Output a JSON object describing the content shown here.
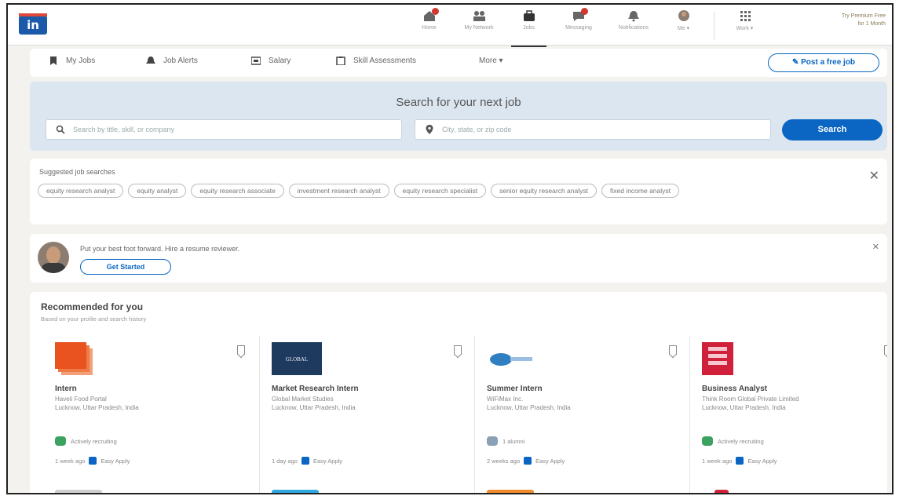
{
  "brand": {
    "logo_text": "in",
    "colors": {
      "primary": "#0a66c2",
      "background": "#f3f2ef",
      "search_panel": "#dce6f1",
      "badge": "#d3362f"
    }
  },
  "top_nav": {
    "items": [
      {
        "label": "Home",
        "icon": "home-icon",
        "badge": true
      },
      {
        "label": "My Network",
        "icon": "network-icon",
        "badge": false
      },
      {
        "label": "Jobs",
        "icon": "briefcase-icon",
        "badge": false,
        "active": true
      },
      {
        "label": "Messaging",
        "icon": "messaging-icon",
        "badge": true
      },
      {
        "label": "Notifications",
        "icon": "bell-icon",
        "badge": false
      },
      {
        "label": "Me ▾",
        "icon": "avatar",
        "badge": false
      },
      {
        "label": "Work ▾",
        "icon": "grid-icon",
        "badge": false
      }
    ],
    "premium_line1": "Try Premium Free",
    "premium_line2": "for 1 Month"
  },
  "sub_nav": {
    "my_jobs": "My Jobs",
    "job_alerts": "Job Alerts",
    "salary": "Salary",
    "skill_assessments": "Skill Assessments",
    "more": "More ▾",
    "post_job": "Post a free job"
  },
  "search": {
    "title": "Search for your next job",
    "keyword_placeholder": "Search by title, skill, or company",
    "location_placeholder": "City, state, or zip code",
    "button": "Search"
  },
  "suggested": {
    "title": "Suggested job searches",
    "close": "✕",
    "pills": [
      "equity research analyst",
      "equity analyst",
      "equity research associate",
      "investment research analyst",
      "equity research specialist",
      "senior equity research analyst",
      "fixed income analyst"
    ]
  },
  "resume": {
    "text": "Put your best foot forward. Hire a resume reviewer.",
    "button": "Get Started",
    "close": "✕"
  },
  "recommended": {
    "title": "Recommended for you",
    "subtitle": "Based on your profile and search history",
    "cards": [
      {
        "title": "Intern",
        "company": "Haveli Food Portal",
        "location": "Lucknow, Uttar Pradesh, India",
        "insight": "Actively recruiting",
        "posted": "1 week ago",
        "apply": "Easy Apply",
        "logo_color": "#e8531f",
        "insight_color": "#3aa35f"
      },
      {
        "title": "Market Research Intern",
        "company": "Global Market Studies",
        "location": "Lucknow, Uttar Pradesh, India",
        "logo_text": "GLOBAL",
        "insight": "",
        "posted": "1 day ago",
        "apply": "Easy Apply",
        "logo_color": "#1f3a5f",
        "insight_color": ""
      },
      {
        "title": "Summer Intern",
        "company": "WiFiMax Inc.",
        "location": "Lucknow, Uttar Pradesh, India",
        "insight": "1 alumni",
        "posted": "2 weeks ago",
        "apply": "Easy Apply",
        "logo_color": "#2f7fc1",
        "insight_color": "#8aa0b5"
      },
      {
        "title": "Business Analyst",
        "company": "Think Room Global Private Limited",
        "location": "Lucknow, Uttar Pradesh, India",
        "insight": "Actively recruiting",
        "posted": "1 week ago",
        "apply": "Easy Apply",
        "logo_color": "#d0203a",
        "insight_color": "#3aa35f"
      }
    ]
  }
}
